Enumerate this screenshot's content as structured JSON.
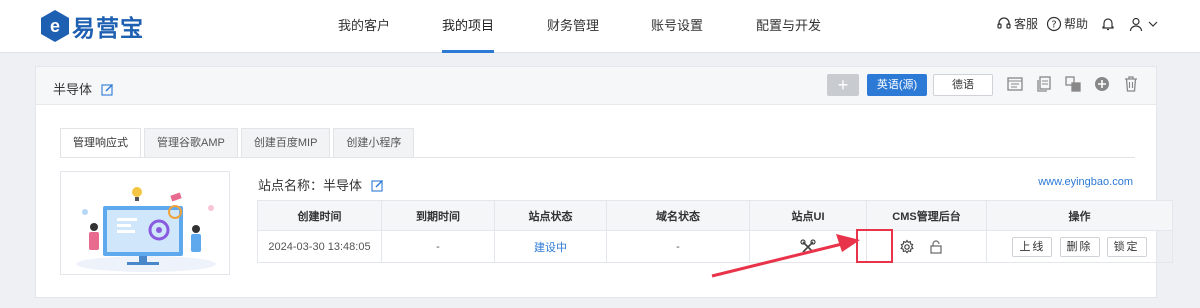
{
  "header": {
    "logo_text": "易营宝",
    "nav": [
      {
        "label": "我的客户",
        "active": false
      },
      {
        "label": "我的项目",
        "active": true
      },
      {
        "label": "财务管理",
        "active": false
      },
      {
        "label": "账号设置",
        "active": false
      },
      {
        "label": "配置与开发",
        "active": false
      }
    ],
    "service_label": "客服",
    "help_label": "帮助",
    "icons": [
      "headset-icon",
      "help-icon",
      "bell-icon",
      "user-icon",
      "chevron-down-icon"
    ]
  },
  "project": {
    "title": "半导体",
    "add_label": "+",
    "lang_primary": "英语(源)",
    "lang_secondary": "德语",
    "toolbar_icons": [
      "folder-icon",
      "copy-icon",
      "transfer-icon",
      "globe-icon",
      "trash-icon"
    ]
  },
  "tabs": [
    {
      "label": "管理响应式",
      "active": true
    },
    {
      "label": "管理谷歌AMP",
      "active": false
    },
    {
      "label": "创建百度MIP",
      "active": false
    },
    {
      "label": "创建小程序",
      "active": false
    }
  ],
  "site": {
    "name_label": "站点名称：半导体",
    "url": "www.eyingbao.com"
  },
  "table": {
    "headers": [
      "创建时间",
      "到期时间",
      "站点状态",
      "域名状态",
      "站点UI",
      "CMS管理后台",
      "操作"
    ],
    "row": {
      "created": "2024-03-30 13:48:05",
      "expires": "-",
      "site_status": "建设中",
      "domain_status": "-",
      "actions": [
        "上线",
        "删除",
        "锁定"
      ]
    }
  },
  "colors": {
    "brand": "#1d5fb1",
    "accent": "#2d7ad6",
    "highlight": "#e8334a"
  }
}
